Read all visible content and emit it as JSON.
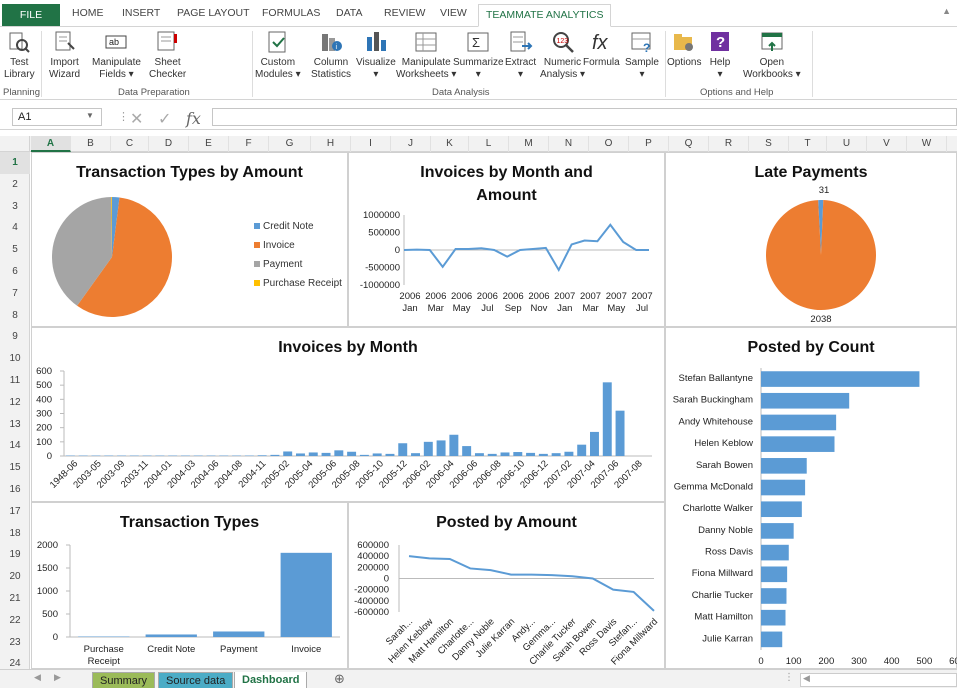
{
  "ribbon_tabs": [
    "FILE",
    "HOME",
    "INSERT",
    "PAGE LAYOUT",
    "FORMULAS",
    "DATA",
    "REVIEW",
    "VIEW",
    "TEAMMATE ANALYTICS"
  ],
  "ribbon_buttons": [
    {
      "label": "Test\nLibrary",
      "icon": "test-library-icon"
    },
    {
      "label": "Import\nWizard",
      "icon": "import-wizard-icon"
    },
    {
      "label": "Manipulate\nFields ▾",
      "icon": "manipulate-fields-icon"
    },
    {
      "label": "Sheet\nChecker",
      "icon": "sheet-checker-icon"
    },
    {
      "label": "Custom\nModules ▾",
      "icon": "custom-modules-icon"
    },
    {
      "label": "Column\nStatistics",
      "icon": "column-statistics-icon"
    },
    {
      "label": "Visualize\n▾",
      "icon": "visualize-icon"
    },
    {
      "label": "Manipulate\nWorksheets ▾",
      "icon": "manipulate-worksheets-icon"
    },
    {
      "label": "Summarize\n▾",
      "icon": "summarize-icon"
    },
    {
      "label": "Extract\n▾",
      "icon": "extract-icon"
    },
    {
      "label": "Numeric\nAnalysis ▾",
      "icon": "numeric-analysis-icon"
    },
    {
      "label": "Formula\n",
      "icon": "formula-icon"
    },
    {
      "label": "Sample\n▾",
      "icon": "sample-icon"
    },
    {
      "label": "Options\n",
      "icon": "options-icon"
    },
    {
      "label": "Help\n▾",
      "icon": "help-icon"
    },
    {
      "label": "Open\nWorkbooks ▾",
      "icon": "open-workbooks-icon"
    }
  ],
  "ribbon_groups": [
    "Planning",
    "Data Preparation",
    "Data Analysis",
    "Options and Help"
  ],
  "formula_bar": {
    "name_box": "A1",
    "value": ""
  },
  "columns": [
    "A",
    "B",
    "C",
    "D",
    "E",
    "F",
    "G",
    "H",
    "I",
    "J",
    "K",
    "L",
    "M",
    "N",
    "O",
    "P",
    "Q",
    "R",
    "S",
    "T",
    "U",
    "V",
    "W"
  ],
  "rows": [
    "1",
    "2",
    "3",
    "4",
    "5",
    "6",
    "7",
    "8",
    "9",
    "10",
    "11",
    "12",
    "13",
    "14",
    "15",
    "16",
    "17",
    "18",
    "19",
    "20",
    "21",
    "22",
    "23",
    "24"
  ],
  "sheet_tabs": [
    {
      "label": "Summary",
      "color": "#9bbb59"
    },
    {
      "label": "Source data",
      "color": "#4bacc6"
    },
    {
      "label": "Dashboard",
      "color": "#ffffff"
    }
  ],
  "colors": {
    "accent": "#217346",
    "blue": "#5b9bd5",
    "orange": "#ed7d31",
    "gray": "#a5a5a5",
    "yellow": "#ffc000"
  },
  "chart_data": [
    {
      "type": "pie",
      "title": "Transaction Types by Amount",
      "categories": [
        "Credit Note",
        "Invoice",
        "Payment",
        "Purchase Receipt"
      ],
      "values": [
        2,
        58,
        40,
        0.2
      ],
      "legend": "right"
    },
    {
      "type": "line",
      "title": "Invoices by Month and Amount",
      "x": [
        "2006 Jan",
        "2006 Feb",
        "2006 Mar",
        "2006 Apr",
        "2006 May",
        "2006 Jun",
        "2006 Jul",
        "2006 Aug",
        "2006 Sep",
        "2006 Oct",
        "2006 Nov",
        "2006 Dec",
        "2007 Jan",
        "2007 Feb",
        "2007 Mar",
        "2007 Apr",
        "2007 May",
        "2007 Jun",
        "2007 Jul",
        "2007 Aug"
      ],
      "x_tick_labels": [
        "2006\nJan",
        "2006\nMar",
        "2006\nMay",
        "2006\nJul",
        "2006\nSep",
        "2006\nNov",
        "2007\nJan",
        "2007\nMar",
        "2007\nMay",
        "2007\nJul"
      ],
      "values": [
        0,
        10000,
        0,
        -480000,
        30000,
        30000,
        50000,
        0,
        -190000,
        0,
        30000,
        60000,
        -570000,
        160000,
        270000,
        250000,
        720000,
        230000,
        0,
        0
      ],
      "ylim": [
        -1000000,
        1000000
      ],
      "yticks": [
        1000000,
        500000,
        0,
        -500000,
        -1000000
      ]
    },
    {
      "type": "pie",
      "title": "Late Payments",
      "values": [
        31,
        2038
      ],
      "data_labels": [
        "31",
        "2038"
      ]
    },
    {
      "type": "bar",
      "title": "Invoices by Month",
      "categories": [
        "1948-06",
        "2003-05",
        "2003-07",
        "2003-09",
        "2003-11",
        "2004-01",
        "2004-02",
        "2004-03",
        "2004-04",
        "2004-06",
        "2004-07",
        "2004-08",
        "2004-10",
        "2004-11",
        "2004-12",
        "2005-02",
        "2005-03",
        "2005-04",
        "2005-05",
        "2005-06",
        "2005-07",
        "2005-08",
        "2005-09",
        "2005-10",
        "2005-11",
        "2005-12",
        "2006-01",
        "2006-02",
        "2006-03",
        "2006-04",
        "2006-05",
        "2006-06",
        "2006-07",
        "2006-08",
        "2006-09",
        "2006-10",
        "2006-11",
        "2006-12",
        "2007-01",
        "2007-02",
        "2007-03",
        "2007-04",
        "2007-05",
        "2007-06",
        "2007-07",
        "2007-08"
      ],
      "x_tick_labels": [
        "1948-06",
        "2003-05",
        "2003-09",
        "2003-11",
        "2004-01",
        "2004-03",
        "2004-06",
        "2004-08",
        "2004-11",
        "2005-02",
        "2005-04",
        "2005-06",
        "2005-08",
        "2005-10",
        "2005-12",
        "2006-02",
        "2006-04",
        "2006-06",
        "2006-08",
        "2006-10",
        "2006-12",
        "2007-02",
        "2007-04",
        "2007-06",
        "2007-08"
      ],
      "values": [
        3,
        3,
        3,
        3,
        3,
        3,
        3,
        3,
        3,
        3,
        3,
        3,
        3,
        3,
        3,
        5,
        8,
        32,
        18,
        25,
        22,
        40,
        30,
        8,
        18,
        15,
        90,
        20,
        100,
        110,
        150,
        70,
        20,
        15,
        25,
        28,
        22,
        15,
        20,
        30,
        80,
        170,
        520,
        320,
        0,
        0
      ],
      "ylim": [
        0,
        600
      ],
      "yticks": [
        0,
        100,
        200,
        300,
        400,
        500,
        600
      ]
    },
    {
      "type": "bar",
      "title": "Transaction Types",
      "categories": [
        "Purchase Receipt",
        "Credit Note",
        "Payment",
        "Invoice"
      ],
      "values": [
        10,
        55,
        120,
        1830
      ],
      "ylim": [
        0,
        2000
      ],
      "yticks": [
        0,
        500,
        1000,
        1500,
        2000
      ]
    },
    {
      "type": "line",
      "title": "Posted by Amount",
      "categories": [
        "Sarah Buckingham",
        "Helen Keblow",
        "Matt Hamilton",
        "Charlotte Walker",
        "Danny Noble",
        "Julie Karran",
        "Andy Whitehouse",
        "Gemma McDonald",
        "Charlie Tucker",
        "Sarah Bowen",
        "Ross Davis",
        "Stefan Ballantyne",
        "Fiona Millward"
      ],
      "x_tick_labels": [
        "Sarah...",
        "Helen Keblow",
        "Matt Hamilton",
        "Charlotte...",
        "Danny Noble",
        "Julie Karran",
        "Andy...",
        "Gemma...",
        "Charlie Tucker",
        "Sarah Bowen",
        "Ross Davis",
        "Stefan...",
        "Fiona Millward"
      ],
      "values": [
        400000,
        360000,
        350000,
        180000,
        150000,
        70000,
        70000,
        60000,
        40000,
        0,
        -200000,
        -240000,
        -580000
      ],
      "ylim": [
        -600000,
        600000
      ],
      "yticks": [
        600000,
        400000,
        200000,
        0,
        -200000,
        -400000,
        -600000
      ]
    },
    {
      "type": "bar",
      "orientation": "horizontal",
      "title": "Posted by Count",
      "categories": [
        "Stefan Ballantyne",
        "Sarah Buckingham",
        "Andy Whitehouse",
        "Helen Keblow",
        "Sarah Bowen",
        "Gemma McDonald",
        "Charlotte Walker",
        "Danny Noble",
        "Ross Davis",
        "Fiona Millward",
        "Charlie Tucker",
        "Matt Hamilton",
        "Julie Karran"
      ],
      "values": [
        485,
        270,
        230,
        225,
        140,
        135,
        125,
        100,
        85,
        80,
        78,
        75,
        65
      ],
      "xlim": [
        0,
        600
      ],
      "xticks": [
        0,
        100,
        200,
        300,
        400,
        500,
        600
      ]
    }
  ]
}
